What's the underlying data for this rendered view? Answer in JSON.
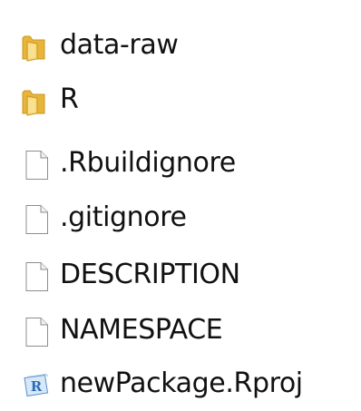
{
  "explorer": {
    "items": [
      {
        "name": "data-raw",
        "type": "folder",
        "icon": "folder-icon"
      },
      {
        "name": "R",
        "type": "folder",
        "icon": "folder-icon"
      },
      {
        "name": ".Rbuildignore",
        "type": "file",
        "icon": "file-icon"
      },
      {
        "name": ".gitignore",
        "type": "file",
        "icon": "file-icon"
      },
      {
        "name": "DESCRIPTION",
        "type": "file",
        "icon": "file-icon"
      },
      {
        "name": "NAMESPACE",
        "type": "file",
        "icon": "file-icon"
      },
      {
        "name": "newPackage.Rproj",
        "type": "rproj",
        "icon": "rproj-icon"
      }
    ],
    "colors": {
      "folder_body": "#e8b53a",
      "folder_front": "#f7d676",
      "folder_edge": "#c9961e",
      "file_fill": "#ffffff",
      "file_stroke": "#8d8d8d",
      "rproj_blue": "#2d6cb5",
      "text": "#111111"
    }
  }
}
